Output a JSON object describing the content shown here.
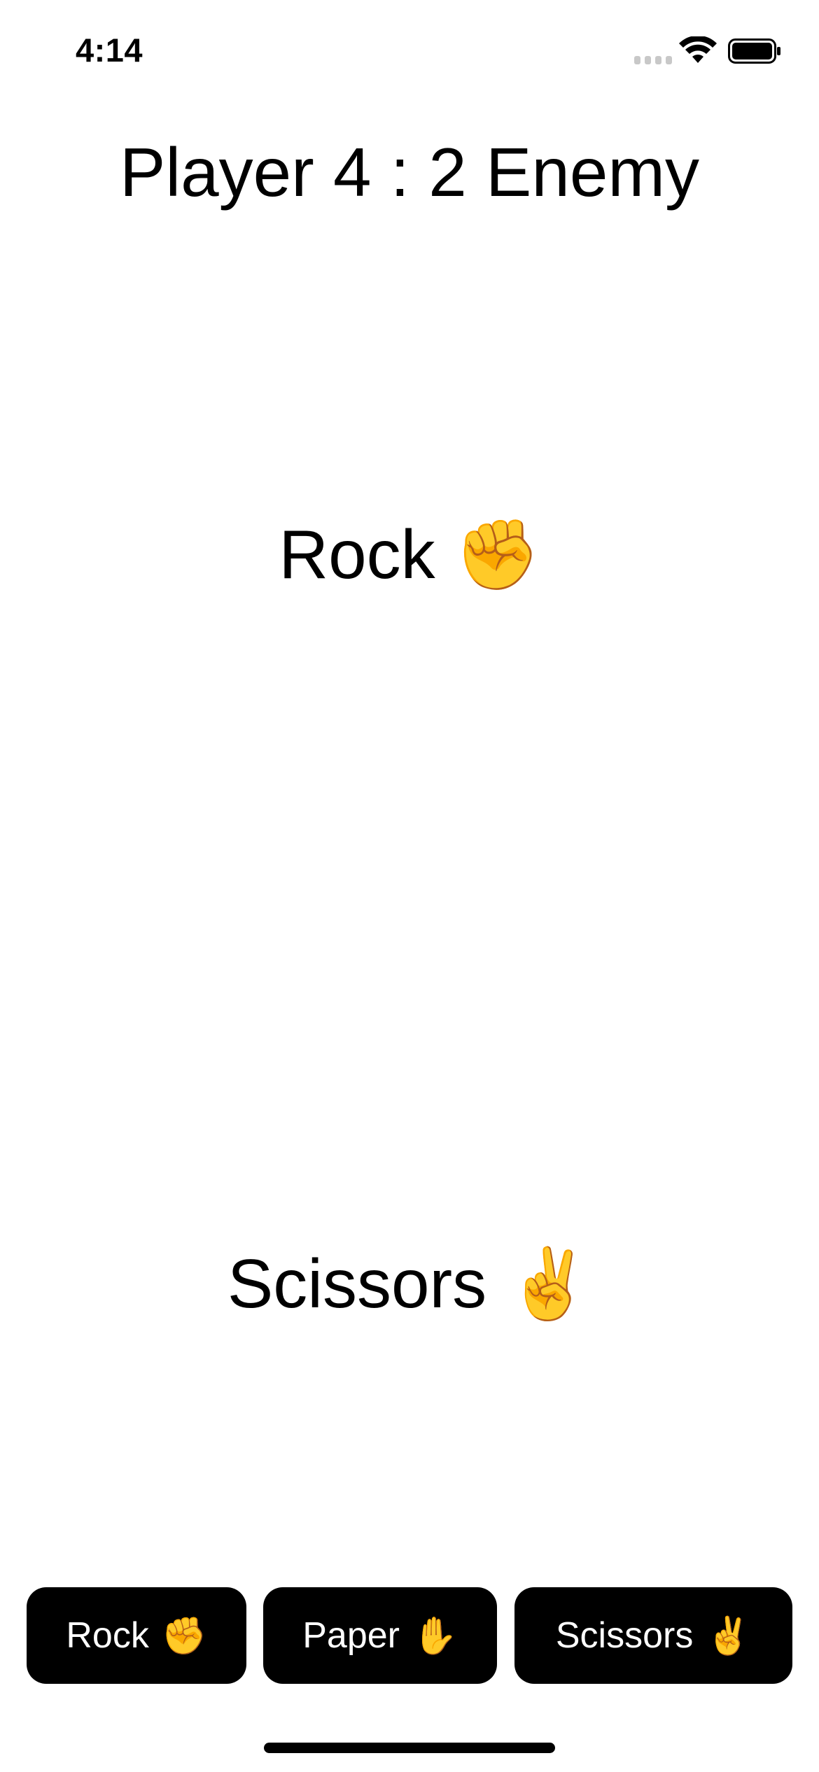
{
  "status_bar": {
    "time": "4:14",
    "signal_icon": "cellular-signal-icon",
    "wifi_icon": "wifi-icon",
    "battery_icon": "battery-full-icon"
  },
  "score": {
    "text": "Player 4 : 2 Enemy"
  },
  "enemy_choice": {
    "label": "Rock",
    "emoji": "✊"
  },
  "player_choice": {
    "label": "Scissors",
    "emoji": "✌️"
  },
  "buttons": {
    "rock": {
      "label": "Rock",
      "emoji": "✊"
    },
    "paper": {
      "label": "Paper",
      "emoji": "✋"
    },
    "scissors": {
      "label": "Scissors",
      "emoji": "✌️"
    }
  }
}
